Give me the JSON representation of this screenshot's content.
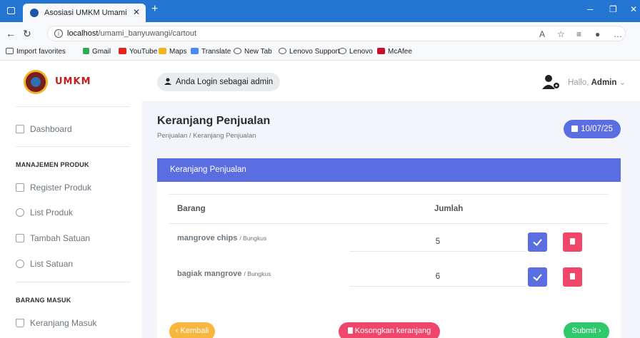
{
  "browser": {
    "tab_title": "Asosiasi UMKM Umami Banyuwa",
    "url_host": "localhost",
    "url_path": "/umami_banyuwangi/cartout",
    "favorites": [
      "Import favorites",
      "Gmail",
      "YouTube",
      "Maps",
      "Translate",
      "New Tab",
      "Lenovo Support",
      "Lenovo",
      "McAfee"
    ]
  },
  "sidebar": {
    "brand": "UMKM",
    "dashboard": "Dashboard",
    "section_produk": "MANAJEMEN PRODUK",
    "register_produk": "Register Produk",
    "list_produk": "List Produk",
    "tambah_satuan": "Tambah Satuan",
    "list_satuan": "List Satuan",
    "section_masuk": "BARANG MASUK",
    "keranjang_masuk": "Keranjang Masuk"
  },
  "topnav": {
    "login_status": "Anda Login sebagai admin",
    "greeting": "Hallo,",
    "user": "Admin"
  },
  "page": {
    "title": "Keranjang Penjualan",
    "breadcrumb": "Penjualan / Keranjang Penjualan",
    "date": "10/07/25"
  },
  "card": {
    "header": "Keranjang Penjualan",
    "columns": [
      "Barang",
      "Jumlah"
    ],
    "rows": [
      {
        "name": "mangrove chips",
        "unit": "/ Bungkus",
        "qty": "5"
      },
      {
        "name": "bagiak mangrove",
        "unit": "/ Bungkus",
        "qty": "6"
      }
    ]
  },
  "actions": {
    "back": "‹ Kembali",
    "clear": "Kosongkan keranjang",
    "submit": "Submit ›"
  },
  "colors": {
    "primary": "#5b6ee1",
    "danger": "#f0466a",
    "warning": "#f9b63e",
    "success": "#2fc96c",
    "browser_bar": "#2474d2"
  }
}
